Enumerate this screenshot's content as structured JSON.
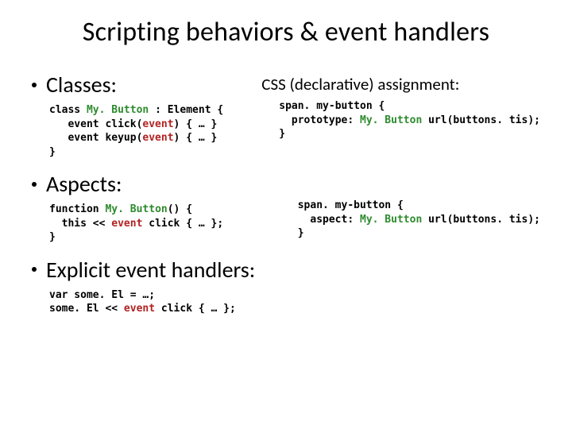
{
  "title": "Scripting behaviors & event handlers",
  "sublabel": "CSS (declarative) assignment:",
  "bullets": {
    "classes": "Classes:",
    "aspects": "Aspects:",
    "explicit": "Explicit event handlers:"
  },
  "code": {
    "classes": {
      "l1a": "class ",
      "l1b": "My. Button",
      "l1c": " : Element {",
      "l2a": "   event click(",
      "l2b": "event",
      "l2c": ") { … }",
      "l3a": "   event keyup(",
      "l3b": "event",
      "l3c": ") { … }",
      "l4": "}"
    },
    "css_classes": {
      "l1": "span. my-button {",
      "l2a": "  prototype: ",
      "l2b": "My. Button",
      "l2c": " url(buttons. tis);",
      "l3": "}"
    },
    "aspects": {
      "l1a": "function ",
      "l1b": "My. Button",
      "l1c": "() {",
      "l2a": "  this << ",
      "l2b": "event",
      "l2c": " click { … };",
      "l3": "}"
    },
    "css_aspects": {
      "l1": "span. my-button {",
      "l2a": "  aspect: ",
      "l2b": "My. Button",
      "l2c": " url(buttons. tis);",
      "l3": "}"
    },
    "explicit": {
      "l1": "var some. El = …;",
      "l2a": "some. El << ",
      "l2b": "event",
      "l2c": " click { … };"
    }
  }
}
